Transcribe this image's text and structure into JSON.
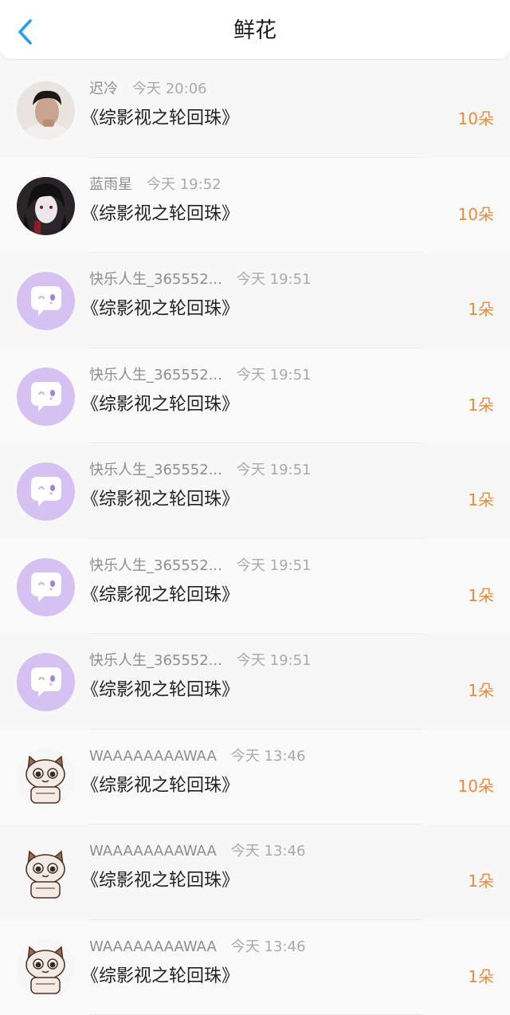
{
  "header": {
    "title": "鲜花",
    "back_icon": "chevron-left-icon",
    "accent": "#2b9cf2"
  },
  "flower_color": "#ef8a3a",
  "items": [
    {
      "avatar": "photo-boy",
      "name": "迟冷",
      "time": "今天 20:06",
      "book": "《综影视之轮回珠》",
      "count": "10朵"
    },
    {
      "avatar": "photo-anime",
      "name": "蓝雨星",
      "time": "今天 19:52",
      "book": "《综影视之轮回珠》",
      "count": "10朵"
    },
    {
      "avatar": "chat-bubble",
      "name": "快乐人生_365552...",
      "time": "今天 19:51",
      "book": "《综影视之轮回珠》",
      "count": "1朵"
    },
    {
      "avatar": "chat-bubble",
      "name": "快乐人生_365552...",
      "time": "今天 19:51",
      "book": "《综影视之轮回珠》",
      "count": "1朵"
    },
    {
      "avatar": "chat-bubble",
      "name": "快乐人生_365552...",
      "time": "今天 19:51",
      "book": "《综影视之轮回珠》",
      "count": "1朵"
    },
    {
      "avatar": "chat-bubble",
      "name": "快乐人生_365552...",
      "time": "今天 19:51",
      "book": "《综影视之轮回珠》",
      "count": "1朵"
    },
    {
      "avatar": "chat-bubble",
      "name": "快乐人生_365552...",
      "time": "今天 19:51",
      "book": "《综影视之轮回珠》",
      "count": "1朵"
    },
    {
      "avatar": "cartoon-cat",
      "name": "WAAAAAAAAWAA",
      "time": "今天 13:46",
      "book": "《综影视之轮回珠》",
      "count": "10朵"
    },
    {
      "avatar": "cartoon-cat",
      "name": "WAAAAAAAAWAA",
      "time": "今天 13:46",
      "book": "《综影视之轮回珠》",
      "count": "1朵"
    },
    {
      "avatar": "cartoon-cat",
      "name": "WAAAAAAAAWAA",
      "time": "今天 13:46",
      "book": "《综影视之轮回珠》",
      "count": "1朵"
    }
  ]
}
